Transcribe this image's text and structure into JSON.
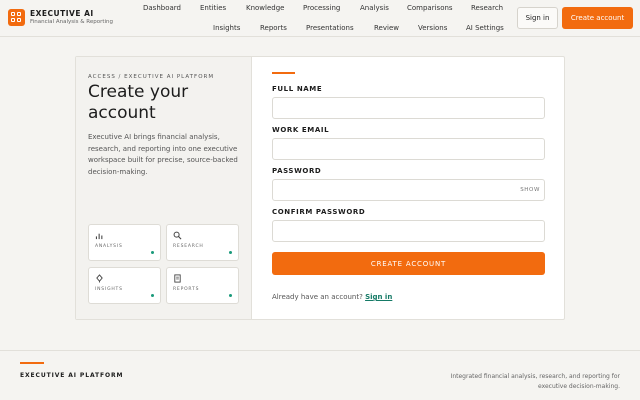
{
  "brand": {
    "name": "EXECUTIVE AI",
    "subtitle": "Financial Analysis & Reporting"
  },
  "nav": {
    "row1": [
      "Dashboard",
      "Entities",
      "Knowledge",
      "Processing",
      "Analysis",
      "Comparisons",
      "Research"
    ],
    "row2": [
      "Insights",
      "Reports",
      "Presentations",
      "Review",
      "Versions",
      "AI Settings"
    ]
  },
  "header_actions": {
    "sign_in": "Sign in",
    "create_account": "Create account"
  },
  "intro": {
    "eyebrow": "ACCESS / EXECUTIVE AI PLATFORM",
    "headline": "Create your account",
    "description": "Executive AI brings financial analysis, research, and reporting into one executive workspace built for precise, source-backed decision-making.",
    "tiles": [
      {
        "label": "ANALYSIS",
        "icon": "bar-chart-icon"
      },
      {
        "label": "RESEARCH",
        "icon": "search-icon"
      },
      {
        "label": "INSIGHTS",
        "icon": "lightbulb-icon"
      },
      {
        "label": "REPORTS",
        "icon": "document-icon"
      }
    ],
    "status_color": "#1a9a7a"
  },
  "form": {
    "full_name_label": "FULL NAME",
    "full_name_value": "",
    "work_email_label": "WORK EMAIL",
    "work_email_value": "",
    "password_label": "PASSWORD",
    "password_value": "",
    "show_label": "SHOW",
    "confirm_password_label": "CONFIRM PASSWORD",
    "confirm_password_value": "",
    "submit_label": "CREATE ACCOUNT",
    "already_text": "Already have an account?",
    "sign_in_link": "Sign in"
  },
  "footer": {
    "name": "EXECUTIVE AI PLATFORM",
    "tagline": "Integrated financial analysis, research, and reporting for executive decision-making."
  },
  "colors": {
    "accent": "#f26b0f",
    "link": "#157a66",
    "background": "#f5f4f1"
  }
}
